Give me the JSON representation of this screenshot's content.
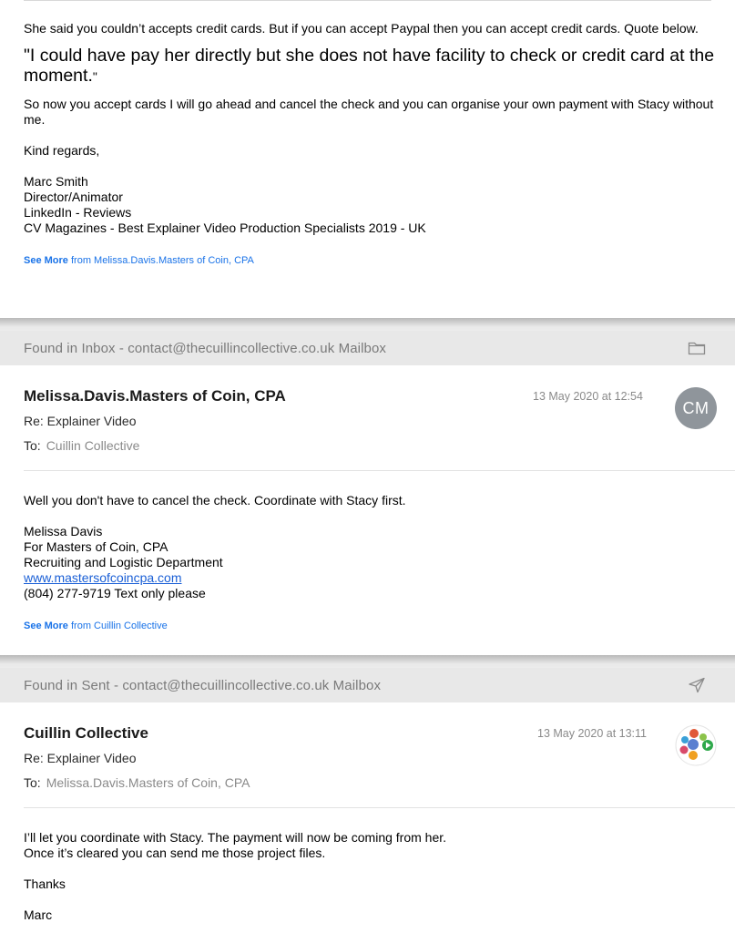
{
  "message1": {
    "paragraph1": "She said you couldn’t accepts credit cards. But if you can accept Paypal then you can accept credit cards. Quote below.",
    "quote": "\"I could have pay her directly but she does not have facility to check or credit card at the moment.",
    "quote_close": "\"",
    "paragraph2": "So now you accept cards I will go ahead and cancel the check and you can organise your own payment with Stacy without me.",
    "closing": "Kind regards,",
    "signature": [
      "Marc Smith",
      "Director/Animator",
      "LinkedIn - Reviews",
      "CV Magazines - Best Explainer Video Production Specialists 2019 - UK"
    ],
    "see_more_label": "See More",
    "see_more_from": "from Melissa.Davis.Masters of Coin, CPA"
  },
  "found_inbox": {
    "text": "Found in Inbox - contact@thecuillincollective.co.uk Mailbox",
    "icon": "folder-icon"
  },
  "message2": {
    "sender": "Melissa.Davis.Masters of Coin, CPA",
    "date": "13 May 2020 at 12:54",
    "subject": "Re: Explainer Video",
    "to_label": "To:",
    "to_value": "Cuillin Collective",
    "avatar_initials": "CM",
    "body": "Well you don't have to cancel the check. Coordinate with Stacy first.",
    "signature": [
      "Melissa Davis",
      "For Masters of Coin, CPA",
      "Recruiting and Logistic Department"
    ],
    "link": "www.mastersofcoincpa.com",
    "phone": "(804) 277-9719 Text only please",
    "see_more_label": "See More",
    "see_more_from": "from Cuillin Collective"
  },
  "found_sent": {
    "text": "Found in Sent - contact@thecuillincollective.co.uk Mailbox",
    "icon": "send-icon"
  },
  "message3": {
    "sender": "Cuillin Collective",
    "date": "13 May 2020 at 13:11",
    "subject": "Re: Explainer Video",
    "to_label": "To:",
    "to_value": "Melissa.Davis.Masters of Coin, CPA",
    "body": [
      "I’ll let you coordinate with Stacy. The payment will now be coming from her.",
      "Once it’s cleared you can send me those project files."
    ],
    "closing": "Thanks",
    "name": "Marc"
  },
  "colors": {
    "link": "#1a73e8",
    "found_bar": "#e8e8e8",
    "avatar": "#8f959b"
  }
}
